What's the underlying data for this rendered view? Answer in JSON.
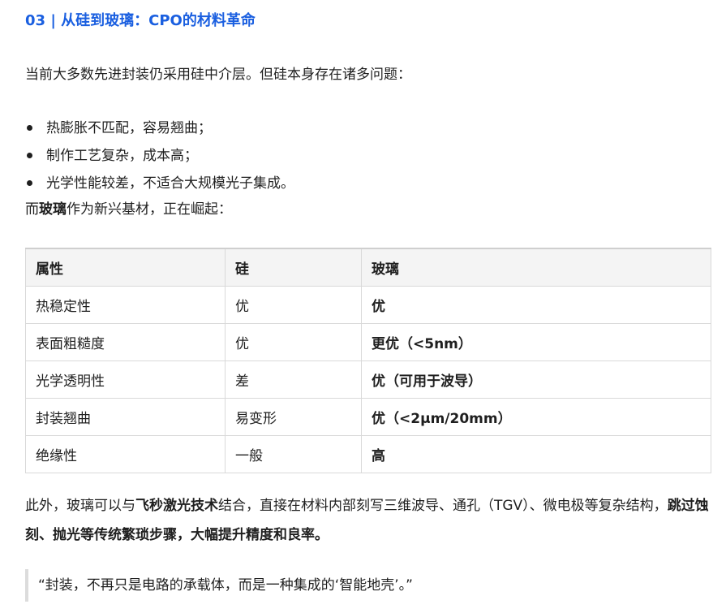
{
  "heading": "03 | 从硅到玻璃：CPO的材料革命",
  "intro": "当前大多数先进封装仍采用硅中介层。但硅本身存在诸多问题：",
  "bullets": [
    "热膨胀不匹配，容易翘曲；",
    "制作工艺复杂，成本高；",
    "光学性能较差，不适合大规模光子集成。"
  ],
  "lead": {
    "pre": "而",
    "bold": "玻璃",
    "post": "作为新兴基材，正在崛起："
  },
  "table": {
    "headers": [
      "属性",
      "硅",
      "玻璃"
    ],
    "rows": [
      [
        "热稳定性",
        "优",
        "优"
      ],
      [
        "表面粗糙度",
        "优",
        "更优（<5nm）"
      ],
      [
        "光学透明性",
        "差",
        "优（可用于波导）"
      ],
      [
        "封装翘曲",
        "易变形",
        "优（<2μm/20mm）"
      ],
      [
        "绝缘性",
        "一般",
        "高"
      ]
    ]
  },
  "outro": {
    "part1": "此外，玻璃可以与",
    "bold1": "飞秒激光技术",
    "part2": "结合，直接在材料内部刻写三维波导、通孔（TGV）、微电极等复杂结构，",
    "bold2": "跳过蚀刻、抛光等传统繁琐步骤，大幅提升精度和良率。"
  },
  "quote": "“封装，不再只是电路的承载体，而是一种集成的‘智能地壳’。”",
  "colors": {
    "heading": "#1a5fe0",
    "text": "#1f1f1f",
    "border": "#d9d9d9",
    "header_bg": "#f4f4f4"
  }
}
